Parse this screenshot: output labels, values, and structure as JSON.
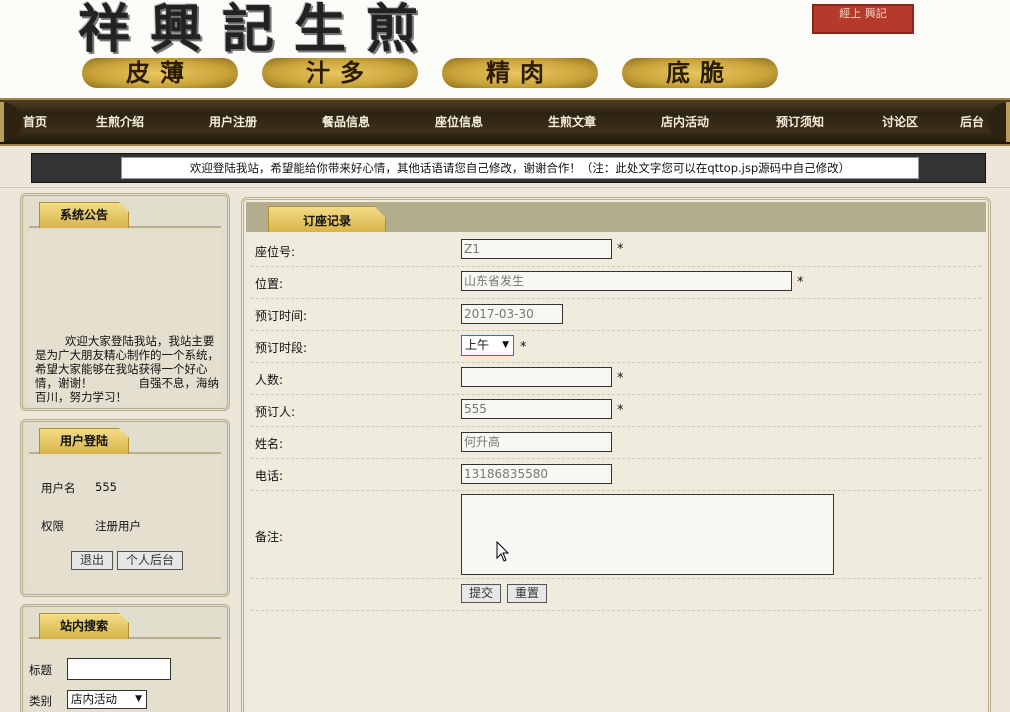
{
  "banner": {
    "title": "祥興記生煎",
    "slogans": [
      "皮薄",
      "汁多",
      "精肉",
      "底脆"
    ],
    "seal": "經上 興記"
  },
  "nav": {
    "items": [
      "首页",
      "生煎介绍",
      "用户注册",
      "餐品信息",
      "座位信息",
      "生煎文章",
      "店内活动",
      "预订须知",
      "讨论区",
      "后台"
    ]
  },
  "notice": "欢迎登陆我站，希望能给你带来好心情，其他话语请您自己修改，谢谢合作！（注：此处文字您可以在qttop.jsp源码中自己修改）",
  "sidebar": {
    "system": {
      "title": "系统公告",
      "text": "欢迎大家登陆我站，我站主要是为广大朋友精心制作的一个系统，希望大家能够在我站获得一个好心情，谢谢！　　　　自强不息，海纳百川，努力学习！"
    },
    "login": {
      "title": "用户登陆",
      "username_label": "用户名",
      "username_value": "555",
      "role_label": "权限",
      "role_value": "注册用户",
      "logout_label": "退出",
      "personal_label": "个人后台"
    },
    "search": {
      "title": "站内搜索",
      "title_label": "标题",
      "title_value": "",
      "category_label": "类别",
      "category_value": "店内活动"
    }
  },
  "main": {
    "tab_title": "订座记录",
    "fields": {
      "seat_no": {
        "label": "座位号:",
        "value": "Z1",
        "required": "*"
      },
      "location": {
        "label": "位置:",
        "value": "山东省发生",
        "required": "*"
      },
      "date": {
        "label": "预订时间:",
        "value": "2017-03-30"
      },
      "period": {
        "label": "预订时段:",
        "value": "上午",
        "required": "*"
      },
      "people": {
        "label": "人数:",
        "value": "",
        "required": "*"
      },
      "booker": {
        "label": "预订人:",
        "value": "555",
        "required": "*"
      },
      "name": {
        "label": "姓名:",
        "value": "何升高"
      },
      "phone": {
        "label": "电话:",
        "value": "13186835580"
      },
      "remark": {
        "label": "备注:",
        "value": ""
      }
    },
    "submit_label": "提交",
    "reset_label": "重置"
  },
  "icons": {
    "select_arrow": "chevron-down-icon",
    "cursor": "mouse-pointer-icon"
  }
}
